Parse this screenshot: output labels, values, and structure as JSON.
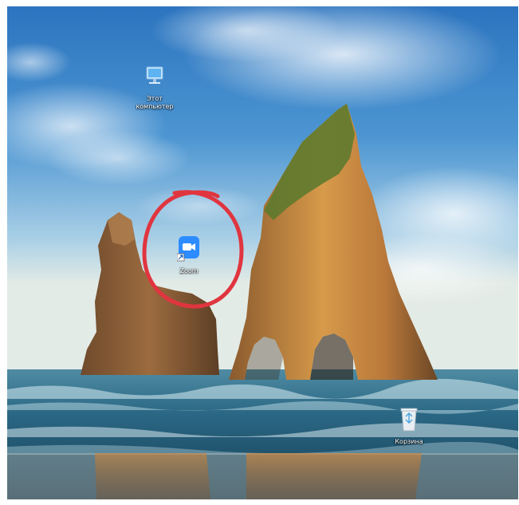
{
  "desktop": {
    "icons": [
      {
        "label": "Этот\nкомпьютер",
        "icon": "this-pc-icon"
      },
      {
        "label": "Zoom",
        "icon": "zoom-app-icon"
      },
      {
        "label": "Корзина",
        "icon": "recycle-bin-icon"
      }
    ]
  },
  "colors": {
    "annotation": "#e0353f",
    "zoom_brand": "#2d8cff"
  }
}
